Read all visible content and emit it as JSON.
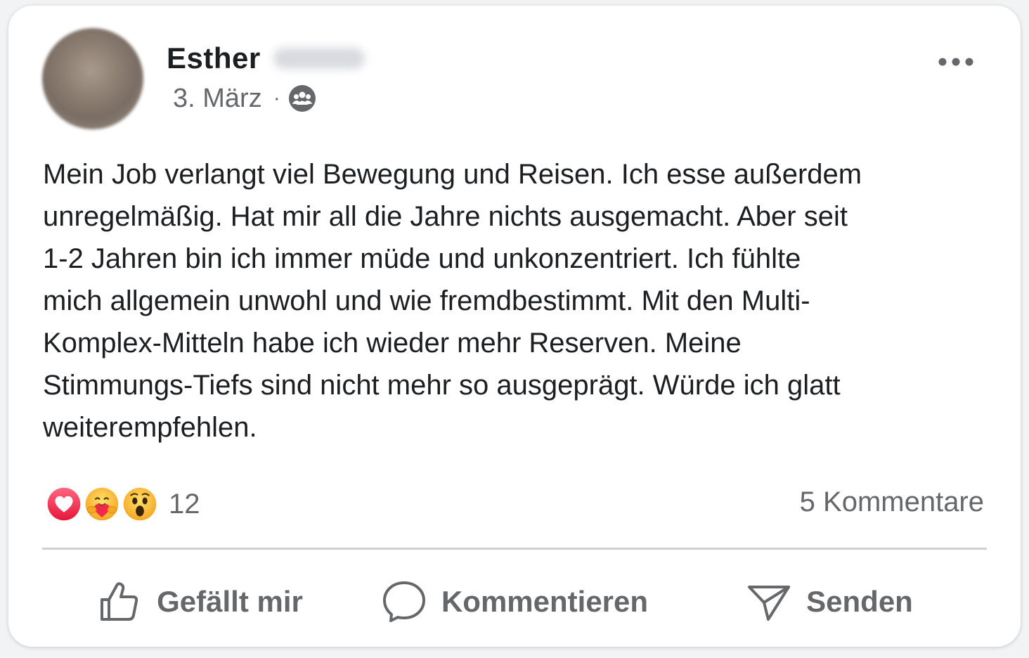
{
  "post": {
    "author_first_name": "Esther",
    "date": "3. März",
    "separator": "·",
    "audience_icon": "group-audience-icon",
    "more_icon": "more-options-icon",
    "text": "Mein Job verlangt viel Bewegung und Reisen. Ich esse außerdem\nunregelmäßig. Hat mir all die Jahre nichts ausgemacht. Aber seit\n1-2 Jahren bin ich immer müde und unkonzentriert. Ich fühlte\nmich allgemein unwohl und wie fremdbestimmt. Mit den Multi-\nKomplex-Mitteln habe ich wieder mehr Reserven. Meine\nStimmungs-Tiefs sind nicht mehr so ausgeprägt. Würde ich glatt\nweiterempfehlen."
  },
  "reactions": {
    "icons": [
      "love-reaction-icon",
      "care-reaction-icon",
      "wow-reaction-icon"
    ],
    "count": "12"
  },
  "comments": {
    "label": "5 Kommentare"
  },
  "actions": {
    "like_label": "Gefällt mir",
    "comment_label": "Kommentieren",
    "send_label": "Senden"
  },
  "colors": {
    "text_primary": "#1c1e21",
    "text_secondary": "#65676b",
    "divider": "#ced0d4",
    "love_red": "#f33e58",
    "emoji_yellow": "#f7b125"
  }
}
